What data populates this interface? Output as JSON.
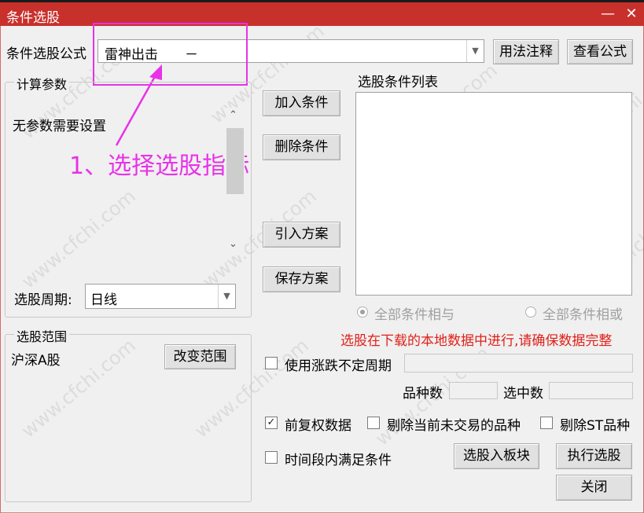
{
  "window": {
    "title": "条件选股",
    "minimize": "—",
    "close": "✕"
  },
  "formula": {
    "label": "条件选股公式",
    "value": "雷神出击　　－",
    "usage_button": "用法注释",
    "view_button": "查看公式"
  },
  "params": {
    "group_label": "计算参数",
    "no_params_text": "无参数需要设置",
    "period_label": "选股周期:",
    "period_value": "日线"
  },
  "annotation": {
    "text": "1、选择选股指标",
    "color": "#e832e8"
  },
  "conditions": {
    "list_label": "选股条件列表",
    "add_button": "加入条件",
    "delete_button": "删除条件",
    "import_button": "引入方案",
    "save_button": "保存方案",
    "radio_and": "全部条件相与",
    "radio_or": "全部条件相或",
    "radio_selected": "and"
  },
  "warning": {
    "text": "选股在下载的本地数据中进行,请确保数据完整",
    "color": "#e0201a"
  },
  "range": {
    "group_label": "选股范围",
    "value": "沪深A股",
    "change_button": "改变范围"
  },
  "options": {
    "uncertain_period_label": "使用涨跌不定周期",
    "uncertain_period_checked": false,
    "variety_count_label": "品种数",
    "selected_count_label": "选中数",
    "fuquan_label": "前复权数据",
    "fuquan_checked": true,
    "exclude_untraded_label": "剔除当前未交易的品种",
    "exclude_untraded_checked": false,
    "exclude_st_label": "剔除ST品种",
    "exclude_st_checked": false,
    "timespan_label": "时间段内满足条件",
    "timespan_checked": false
  },
  "actions": {
    "to_block_button": "选股入板块",
    "run_button": "执行选股",
    "close_button": "关闭"
  },
  "watermark": "www.cfchi.com"
}
